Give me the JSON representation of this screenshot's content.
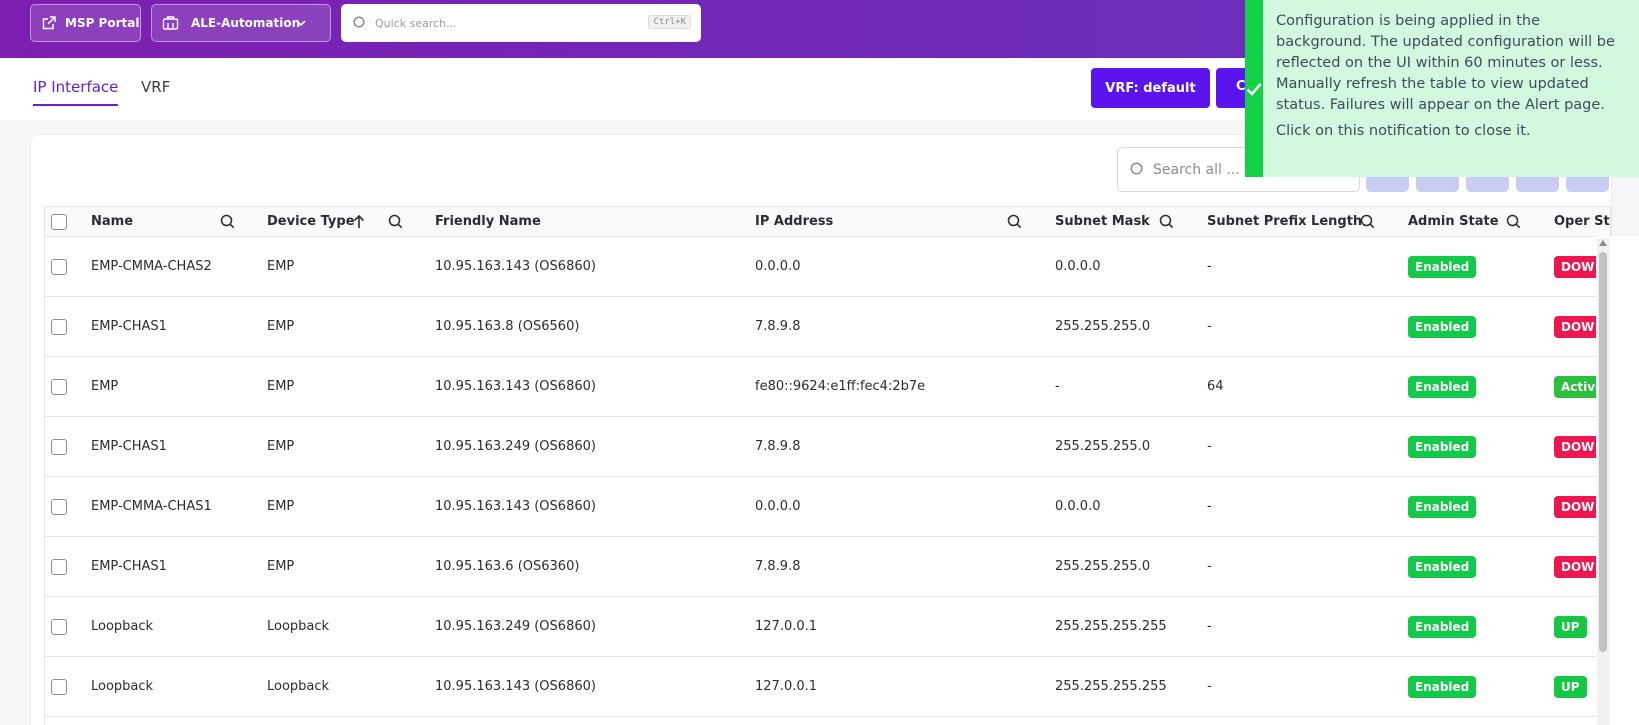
{
  "topbar": {
    "msp_label": "MSP Portal",
    "org_label": "ALE-Automation",
    "search_placeholder": "Quick search...",
    "search_shortcut": "Ctrl+K"
  },
  "tabs": [
    {
      "label": "IP Interface",
      "active": true
    },
    {
      "label": "VRF",
      "active": false
    }
  ],
  "actions": {
    "vrf_button": "VRF: default",
    "second_button_partial": "C"
  },
  "table": {
    "search_placeholder": "Search all ...",
    "columns": [
      "Name",
      "Device Type",
      "Friendly Name",
      "IP Address",
      "Subnet Mask",
      "Subnet Prefix Length",
      "Admin State",
      "Oper Stat"
    ],
    "rows": [
      {
        "name": "EMP-CMMA-CHAS2",
        "device_type": "EMP",
        "friendly_name": "10.95.163.143 (OS6860)",
        "ip": "0.0.0.0",
        "mask": "0.0.0.0",
        "prefix": "-",
        "admin": "Enabled",
        "oper": "DOW",
        "oper_status": "down"
      },
      {
        "name": "EMP-CHAS1",
        "device_type": "EMP",
        "friendly_name": "10.95.163.8 (OS6560)",
        "ip": "7.8.9.8",
        "mask": "255.255.255.0",
        "prefix": "-",
        "admin": "Enabled",
        "oper": "DOW",
        "oper_status": "down"
      },
      {
        "name": "EMP",
        "device_type": "EMP",
        "friendly_name": "10.95.163.143 (OS6860)",
        "ip": "fe80::9624:e1ff:fec4:2b7e",
        "mask": "-",
        "prefix": "64",
        "admin": "Enabled",
        "oper": "Active",
        "oper_status": "active"
      },
      {
        "name": "EMP-CHAS1",
        "device_type": "EMP",
        "friendly_name": "10.95.163.249 (OS6860)",
        "ip": "7.8.9.8",
        "mask": "255.255.255.0",
        "prefix": "-",
        "admin": "Enabled",
        "oper": "DOW",
        "oper_status": "down"
      },
      {
        "name": "EMP-CMMA-CHAS1",
        "device_type": "EMP",
        "friendly_name": "10.95.163.143 (OS6860)",
        "ip": "0.0.0.0",
        "mask": "0.0.0.0",
        "prefix": "-",
        "admin": "Enabled",
        "oper": "DOW",
        "oper_status": "down"
      },
      {
        "name": "EMP-CHAS1",
        "device_type": "EMP",
        "friendly_name": "10.95.163.6 (OS6360)",
        "ip": "7.8.9.8",
        "mask": "255.255.255.0",
        "prefix": "-",
        "admin": "Enabled",
        "oper": "DOW",
        "oper_status": "down"
      },
      {
        "name": "Loopback",
        "device_type": "Loopback",
        "friendly_name": "10.95.163.249 (OS6860)",
        "ip": "127.0.0.1",
        "mask": "255.255.255.255",
        "prefix": "-",
        "admin": "Enabled",
        "oper": "UP",
        "oper_status": "up"
      },
      {
        "name": "Loopback",
        "device_type": "Loopback",
        "friendly_name": "10.95.163.143 (OS6860)",
        "ip": "127.0.0.1",
        "mask": "255.255.255.255",
        "prefix": "-",
        "admin": "Enabled",
        "oper": "UP",
        "oper_status": "up"
      }
    ]
  },
  "toast": {
    "message": "Configuration is being applied in the background. The updated configuration will be reflected on the UI within 60 minutes or less. Manually refresh the table to view updated status. Failures will appear on the Alert page.",
    "close_hint": "Click on this notification to close it."
  },
  "colors": {
    "brand": "#6a1fd0",
    "button": "#5b14ee",
    "enabled": "#12c94a",
    "down": "#f0164f",
    "toast_bg": "#d2f9df",
    "toast_bar": "#12d146"
  }
}
